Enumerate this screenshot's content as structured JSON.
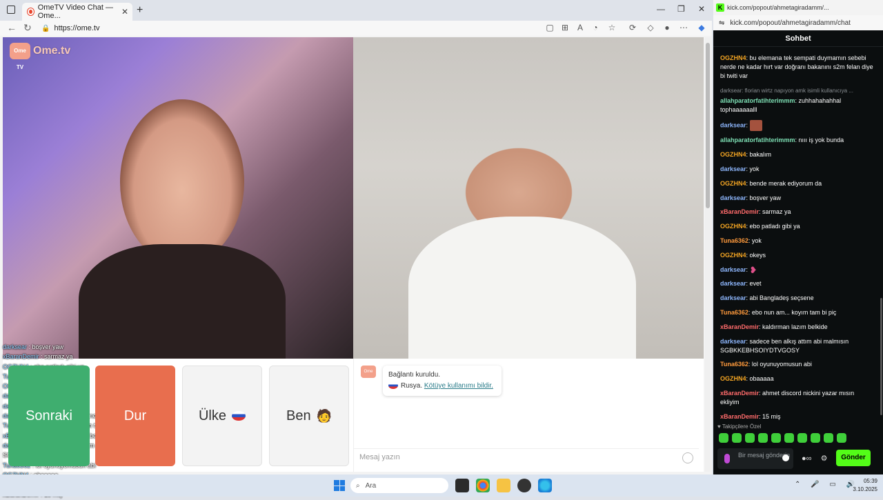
{
  "browser": {
    "tab_title": "OmeTV Video Chat — Ome...",
    "url": "https://ome.tv"
  },
  "ometv": {
    "logo_text": "Ome.tv",
    "logo_badge": "Ome TV",
    "buttons": {
      "next": "Sonraki",
      "stop": "Dur",
      "country": "Ülke",
      "me": "Ben"
    },
    "system_message": {
      "line1": "Bağlantı kuruldu.",
      "country": "Rusya.",
      "report_link": "Kötüye kullanımı bildir."
    },
    "message_placeholder": "Mesaj yazın",
    "overlay_chat": [
      {
        "user": "darksear",
        "text": "boşver yaw"
      },
      {
        "user": "xBaranDemir",
        "text": "sarmaz ya"
      },
      {
        "user": "OGZHN4",
        "text": "ebo patladı gibi ya"
      },
      {
        "user": "Tuna6362",
        "text": "yok"
      },
      {
        "user": "OGZHN4",
        "text": "okeys"
      },
      {
        "user": "darksear",
        "text": ""
      },
      {
        "user": "darksear",
        "text": "evet"
      },
      {
        "user": "darksear",
        "text": "abi Bangladeş seçsene"
      },
      {
        "user": "Tuna6362",
        "text": "ebo nun am... koyım tam bi piç"
      },
      {
        "user": "xBaranDemir",
        "text": "kaldırman lazım belkide"
      },
      {
        "user": "darksear",
        "text": "sadece ben alkış attım abi malmısın SGBKKEBHSOIYDTVGOSY"
      },
      {
        "user": "Tuna6362",
        "text": "lol oyunuyomusun abi"
      },
      {
        "user": "OGZHN4",
        "text": "obaaaaa"
      },
      {
        "user": "xBaranDemir",
        "text": "ahmet discord nickini yazar mısın ekliyim"
      },
      {
        "user": "xBaranDemir",
        "text": "15 miş"
      }
    ]
  },
  "kick": {
    "window_url": "kick.com/popout/ahmetagiradamm/...",
    "address": "kick.com/popout/ahmetagiradamm/chat",
    "header": "Sohbet",
    "messages": [
      {
        "user": "OGZHN4",
        "color": "#f5a623",
        "text": "bu elemana tek sempati duymamın sebebi nerde ne kadar hırt var doğranı bakanını s2m felan diye bi twiti var"
      },
      {
        "reply": "darksear: florian wirtz napıyon amk isimli kullanıcıya ..."
      },
      {
        "user": "allahparatorfatihterimmm",
        "color": "#7ee0b5",
        "text": "zuhhahahahhal tophaaaaaalll"
      },
      {
        "user": "darksear",
        "color": "#8fb8ff",
        "text": "",
        "emote": "thumb"
      },
      {
        "user": "allahparatorfatihterimmm",
        "color": "#7ee0b5",
        "text": "nııı iş yok bunda"
      },
      {
        "user": "OGZHN4",
        "color": "#f5a623",
        "text": "bakalım"
      },
      {
        "user": "darksear",
        "color": "#8fb8ff",
        "text": "yok"
      },
      {
        "user": "OGZHN4",
        "color": "#f5a623",
        "text": "bende merak ediyorum da"
      },
      {
        "user": "darksear",
        "color": "#8fb8ff",
        "text": "boşver yaw"
      },
      {
        "user": "xBaranDemir",
        "color": "#ff6b6b",
        "text": "sarmaz ya"
      },
      {
        "user": "OGZHN4",
        "color": "#f5a623",
        "text": "ebo patladı gibi ya"
      },
      {
        "user": "Tuna6362",
        "color": "#ff9a3c",
        "text": "yok"
      },
      {
        "user": "OGZHN4",
        "color": "#f5a623",
        "text": "okeys"
      },
      {
        "user": "darksear",
        "color": "#8fb8ff",
        "text": "",
        "emote": "heart"
      },
      {
        "user": "darksear",
        "color": "#8fb8ff",
        "text": "evet"
      },
      {
        "user": "darksear",
        "color": "#8fb8ff",
        "text": "abi Bangladeş seçsene"
      },
      {
        "user": "Tuna6362",
        "color": "#ff9a3c",
        "text": "ebo nun am... koyım tam bi piç"
      },
      {
        "user": "xBaranDemir",
        "color": "#ff6b6b",
        "text": "kaldırman lazım belkide"
      },
      {
        "user": "darksear",
        "color": "#8fb8ff",
        "text": "sadece ben alkış attım abi malmısın SGBKKEBHSOIYDTVGOSY"
      },
      {
        "user": "Tuna6362",
        "color": "#ff9a3c",
        "text": "lol oyunuyomusun abi"
      },
      {
        "user": "OGZHN4",
        "color": "#f5a623",
        "text": "obaaaaa"
      },
      {
        "user": "xBaranDemir",
        "color": "#ff6b6b",
        "text": "ahmet discord nickini yazar mısın ekliyim"
      },
      {
        "user": "xBaranDemir",
        "color": "#ff6b6b",
        "text": "15 miş"
      }
    ],
    "followers_only": "Takipçilere Özel",
    "input_placeholder": "Bir mesaj gönderin",
    "send_label": "Gönder",
    "accent": "#53fc18"
  },
  "taskbar": {
    "search_placeholder": "Ara",
    "time": "05:39",
    "date": "3.10.2025"
  }
}
